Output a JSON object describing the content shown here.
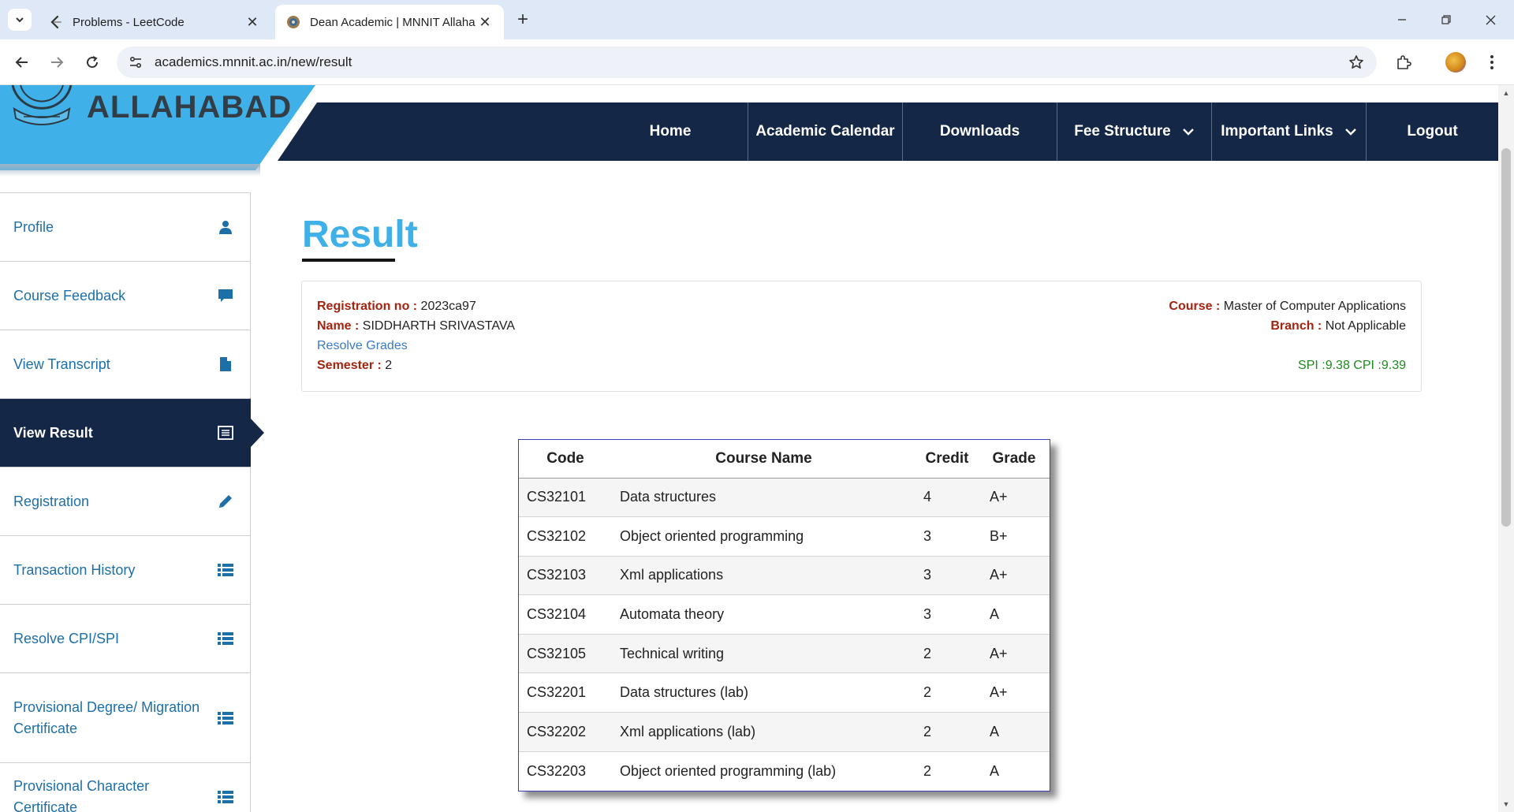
{
  "browser": {
    "tabs": [
      {
        "title": "Problems - LeetCode",
        "active": false
      },
      {
        "title": "Dean Academic | MNNIT Allaha",
        "active": true
      }
    ],
    "url": "academics.mnnit.ac.in/new/result"
  },
  "header": {
    "logo_text": "ALLAHABAD",
    "nav": [
      "Home",
      "Academic Calendar",
      "Downloads",
      "Fee Structure",
      "Important Links",
      "Logout"
    ]
  },
  "sidebar": {
    "items": [
      {
        "label": "Profile",
        "icon": "user-icon"
      },
      {
        "label": "Course Feedback",
        "icon": "comment-icon"
      },
      {
        "label": "View Transcript",
        "icon": "file-icon"
      },
      {
        "label": "View Result",
        "icon": "list-alt-icon",
        "active": true
      },
      {
        "label": "Registration",
        "icon": "pencil-icon"
      },
      {
        "label": "Transaction History",
        "icon": "list-icon"
      },
      {
        "label": "Resolve CPI/SPI",
        "icon": "list-icon"
      },
      {
        "label": "Provisional Degree/ Migration Certificate",
        "icon": "list-icon"
      },
      {
        "label": "Provisional Character Certificate",
        "icon": "list-icon"
      }
    ]
  },
  "main": {
    "title": "Result",
    "info": {
      "registration_label": "Registration no :",
      "registration_value": " 2023ca97",
      "name_label": "Name :",
      "name_value": " SIDDHARTH SRIVASTAVA",
      "resolve_link": "Resolve Grades",
      "semester_label": "Semester :",
      "semester_value": " 2",
      "course_label": "Course :",
      "course_value": " Master of Computer Applications",
      "branch_label": "Branch :",
      "branch_value": " Not Applicable",
      "spi_cpi": "SPI :9.38 CPI :9.39"
    },
    "table": {
      "headers": [
        "Code",
        "Course Name",
        "Credit",
        "Grade"
      ],
      "rows": [
        [
          "CS32101",
          "Data structures",
          "4",
          "A+"
        ],
        [
          "CS32102",
          "Object oriented programming",
          "3",
          "B+"
        ],
        [
          "CS32103",
          "Xml applications",
          "3",
          "A+"
        ],
        [
          "CS32104",
          "Automata theory",
          "3",
          "A"
        ],
        [
          "CS32105",
          "Technical writing",
          "2",
          "A+"
        ],
        [
          "CS32201",
          "Data structures (lab)",
          "2",
          "A+"
        ],
        [
          "CS32202",
          "Xml applications (lab)",
          "2",
          "A"
        ],
        [
          "CS32203",
          "Object oriented programming (lab)",
          "2",
          "A"
        ]
      ]
    }
  },
  "colors": {
    "nav_bg": "#142747",
    "accent_blue": "#3fb0e8",
    "label_red": "#a5230f",
    "spi_green": "#1f8a1f"
  }
}
